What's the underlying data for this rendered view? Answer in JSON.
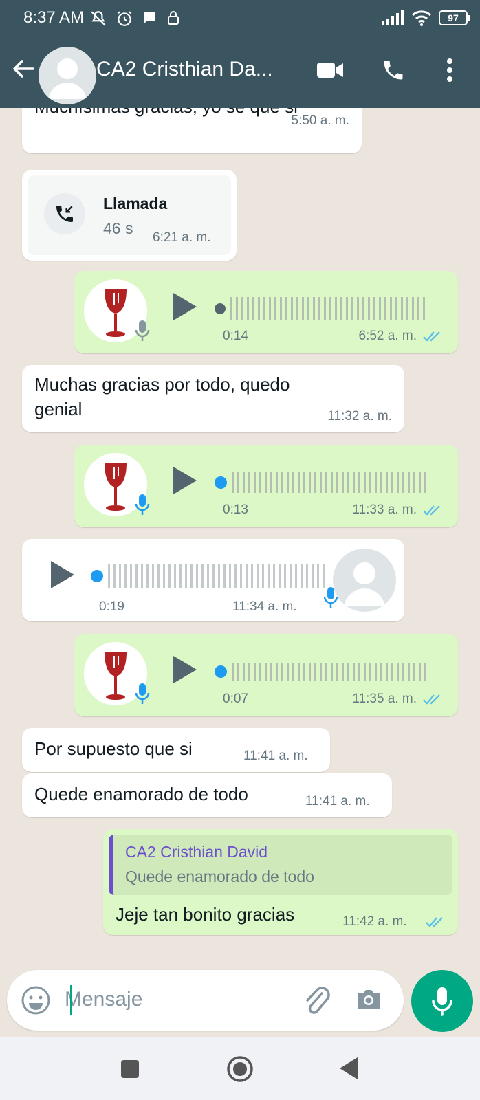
{
  "status_bar": {
    "time": "8:37 AM",
    "battery": "97"
  },
  "header": {
    "contact_name": "CA2 Cristhian Da..."
  },
  "messages": {
    "m0": {
      "text": "Muchísimas gracias, yo se que si",
      "time": "5:50 a. m."
    },
    "m1": {
      "title": "Llamada",
      "duration": "46 s",
      "time": "6:21 a. m."
    },
    "m2": {
      "duration": "0:14",
      "time": "6:52 a. m."
    },
    "m3": {
      "text_line1": "Muchas gracias por todo, quedo",
      "text_line2": "genial",
      "time": "11:32 a. m."
    },
    "m4": {
      "duration": "0:13",
      "time": "11:33 a. m."
    },
    "m5": {
      "duration": "0:19",
      "time": "11:34 a. m."
    },
    "m6": {
      "duration": "0:07",
      "time": "11:35 a. m."
    },
    "m7": {
      "text": "Por supuesto que si",
      "time": "11:41 a. m."
    },
    "m8": {
      "text": "Quede enamorado de todo",
      "time": "11:41 a. m."
    },
    "m9": {
      "quote_author": "CA2 Cristhian David",
      "quote_text": "Quede enamorado de todo",
      "text": "Jeje tan bonito gracias",
      "time": "11:42 a. m."
    }
  },
  "composer": {
    "placeholder": "Mensaje"
  },
  "colors": {
    "header_bg": "#3b5560",
    "chat_bg": "#ece5dd",
    "outgoing_bubble": "#dcf8c6",
    "incoming_bubble": "#ffffff",
    "accent_green": "#00a884",
    "read_ticks": "#53bdeb",
    "quote_author": "#6b4fcf",
    "waveform_played_dot": "#1d9bf0"
  },
  "icons": {
    "back": "arrow-left-icon",
    "video": "video-camera-icon",
    "call": "phone-icon",
    "menu": "more-vertical-icon",
    "emoji": "emoji-icon",
    "attach": "paperclip-icon",
    "camera": "camera-icon",
    "mic": "microphone-icon"
  }
}
